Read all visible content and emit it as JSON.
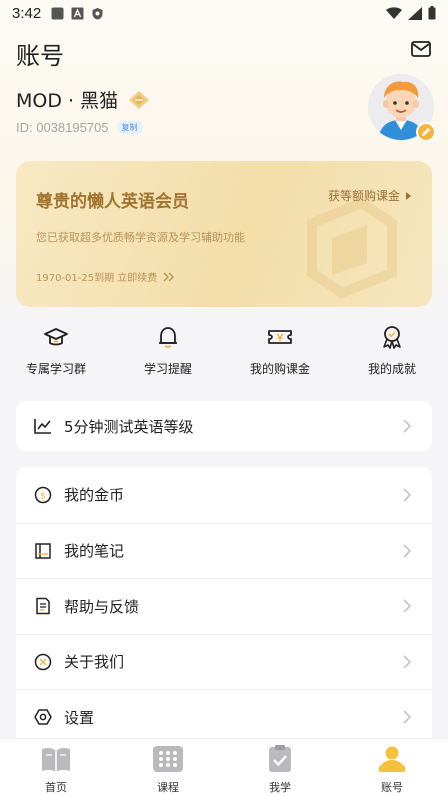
{
  "status_bar": {
    "time": "3:42"
  },
  "header": {
    "title": "账号"
  },
  "profile": {
    "username": "MOD · 黑猫",
    "uid": "ID: 0038195705",
    "copy_label": "复制"
  },
  "vip_card": {
    "title": "尊贵的懒人英语会员",
    "link": "获等额购课金",
    "desc": "您已获取超多优质畅学资源及学习辅助功能",
    "expire": "1970-01-25到期 立即续费"
  },
  "quick_actions": [
    {
      "label": "专属学习群",
      "icon": "graduation-cap-icon"
    },
    {
      "label": "学习提醒",
      "icon": "bell-icon"
    },
    {
      "label": "我的购课金",
      "icon": "ticket-icon"
    },
    {
      "label": "我的成就",
      "icon": "medal-icon"
    }
  ],
  "test_card": {
    "label": "5分钟测试英语等级",
    "icon": "trend-chart-icon"
  },
  "menu": [
    {
      "label": "我的金币",
      "icon": "coin-icon"
    },
    {
      "label": "我的笔记",
      "icon": "notebook-icon"
    },
    {
      "label": "帮助与反馈",
      "icon": "help-doc-icon"
    },
    {
      "label": "关于我们",
      "icon": "about-icon"
    },
    {
      "label": "设置",
      "icon": "settings-hex-icon"
    }
  ],
  "tabbar": [
    {
      "label": "首页",
      "icon": "book-icon"
    },
    {
      "label": "课程",
      "icon": "grid-icon"
    },
    {
      "label": "我学",
      "icon": "clipboard-check-icon"
    },
    {
      "label": "账号",
      "icon": "person-icon",
      "active": true
    }
  ],
  "colors": {
    "gold": "#a0742d",
    "accent": "#f4b53a",
    "card_bg": "#f3dea9"
  }
}
